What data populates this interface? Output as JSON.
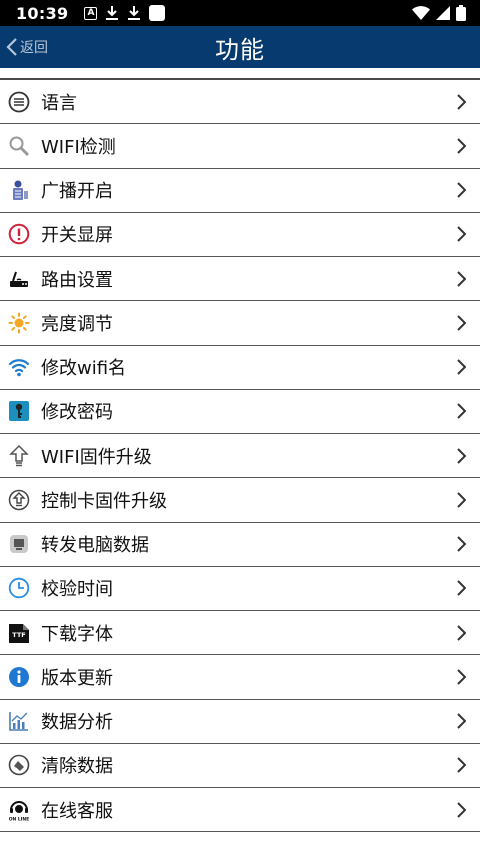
{
  "status_bar": {
    "time": "10:39",
    "notification_icons": [
      "a-icon",
      "download-icon",
      "download-icon",
      "square-icon"
    ],
    "system_icons": [
      "wifi-icon",
      "cellular-icon",
      "battery-icon"
    ]
  },
  "header": {
    "back_label": "返回",
    "title": "功能",
    "background": "#073a6e"
  },
  "menu": {
    "items": [
      {
        "label": "语言",
        "icon": "language-icon"
      },
      {
        "label": "WIFI检测",
        "icon": "magnifier-icon"
      },
      {
        "label": "广播开启",
        "icon": "broadcast-icon"
      },
      {
        "label": "开关显屏",
        "icon": "power-icon"
      },
      {
        "label": "路由设置",
        "icon": "router-icon"
      },
      {
        "label": "亮度调节",
        "icon": "sun-icon"
      },
      {
        "label": "修改wifi名",
        "icon": "wifi-icon"
      },
      {
        "label": "修改密码",
        "icon": "key-icon"
      },
      {
        "label": "WIFI固件升级",
        "icon": "upload-arrow-icon"
      },
      {
        "label": "控制卡固件升级",
        "icon": "upgrade-circle-icon"
      },
      {
        "label": "转发电脑数据",
        "icon": "computer-icon"
      },
      {
        "label": "校验时间",
        "icon": "clock-icon"
      },
      {
        "label": "下载字体",
        "icon": "ttf-icon"
      },
      {
        "label": "版本更新",
        "icon": "info-icon"
      },
      {
        "label": "数据分析",
        "icon": "chart-icon"
      },
      {
        "label": "清除数据",
        "icon": "clear-icon"
      },
      {
        "label": "在线客服",
        "icon": "online-service-icon"
      }
    ]
  }
}
